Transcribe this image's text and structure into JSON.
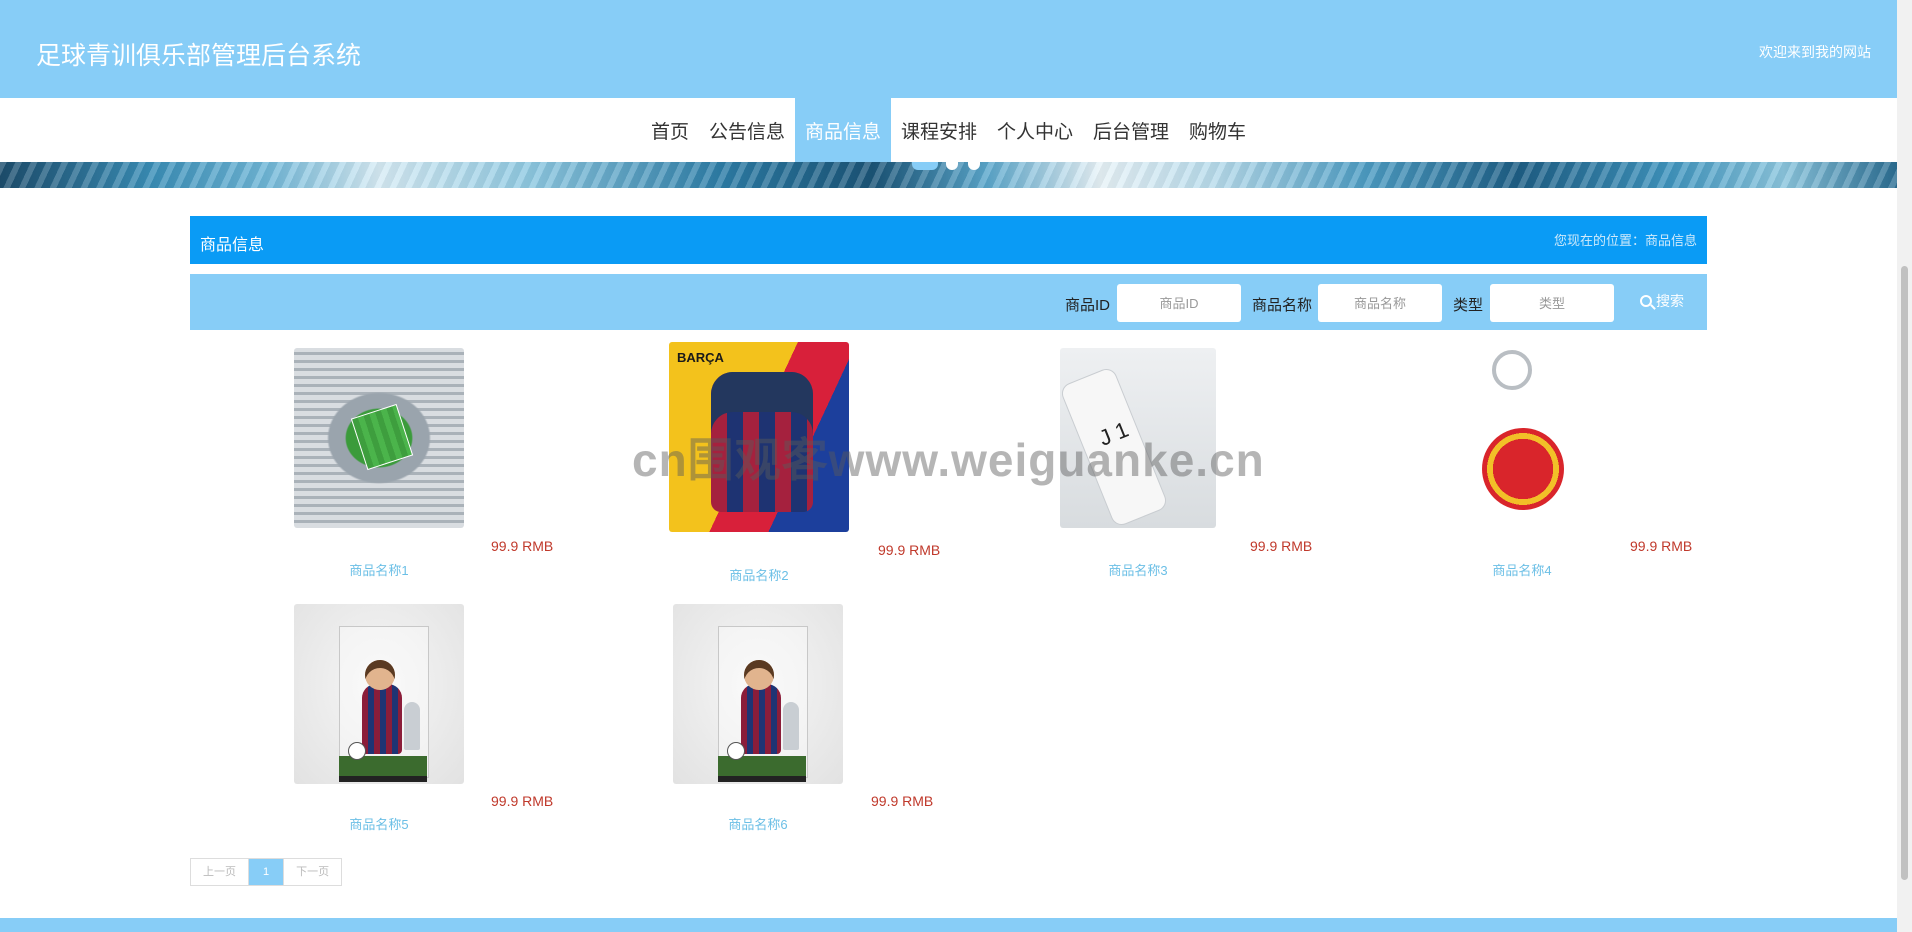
{
  "header": {
    "site_title": "足球青训俱乐部管理后台系统",
    "welcome": "欢迎来到我的网站"
  },
  "nav": {
    "items": [
      {
        "label": "首页"
      },
      {
        "label": "公告信息"
      },
      {
        "label": "商品信息",
        "active": true
      },
      {
        "label": "课程安排"
      },
      {
        "label": "个人中心"
      },
      {
        "label": "后台管理"
      },
      {
        "label": "购物车"
      }
    ]
  },
  "title_bar": {
    "title": "商品信息",
    "breadcrumb": "您现在的位置：商品信息"
  },
  "search": {
    "id_label": "商品ID",
    "id_placeholder": "商品ID",
    "name_label": "商品名称",
    "name_placeholder": "商品名称",
    "type_label": "类型",
    "type_placeholder": "类型",
    "button_label": "搜索"
  },
  "products": [
    {
      "name": "商品名称1",
      "price": "99.9 RMB",
      "image": "stadium-model"
    },
    {
      "name": "商品名称2",
      "price": "99.9 RMB",
      "image": "barca-backpack"
    },
    {
      "name": "商品名称3",
      "price": "99.9 RMB",
      "image": "juventus-bottle"
    },
    {
      "name": "商品名称4",
      "price": "99.9 RMB",
      "image": "manchester-united-keyring"
    },
    {
      "name": "商品名称5",
      "price": "99.9 RMB",
      "image": "messi-figure"
    },
    {
      "name": "商品名称6",
      "price": "99.9 RMB",
      "image": "messi-figure"
    }
  ],
  "pagination": {
    "prev": "上一页",
    "current": "1",
    "next": "下一页"
  },
  "watermark": "cn围观客www.weiguanke.cn",
  "colors": {
    "header": "#87cdf7",
    "title_bar": "#0a9bf5",
    "price": "#c0392b",
    "product_name": "#6bbfe6"
  }
}
